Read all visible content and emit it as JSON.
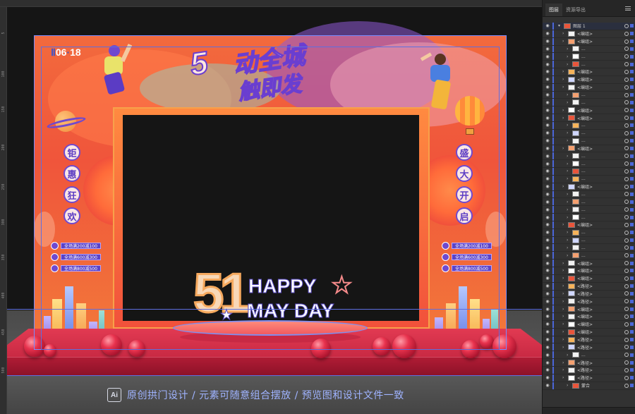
{
  "panel": {
    "tabs": [
      "图层",
      "资源导出"
    ],
    "top_layer": "图层 1",
    "rows": [
      "<编组>",
      "<编组>",
      "...",
      "...",
      "...",
      "<编组>",
      "<编组>",
      "<编组>",
      "...",
      "...",
      "<编组>",
      "<编组>",
      "...",
      "...",
      "...",
      "<编组>",
      "...",
      "...",
      "...",
      "...",
      "<编组>",
      "...",
      "...",
      "...",
      "...",
      "<编组>",
      "...",
      "...",
      "...",
      "...",
      "<编组>",
      "<编组>",
      "<编组>",
      "<路径>",
      "<路径>",
      "<路径>",
      "<编组>",
      "<编组>",
      "<编组>",
      "<编组>",
      "<路径>",
      "<路径>",
      "...",
      "<路径>",
      "<路径>",
      "<路径>",
      "蒙合"
    ]
  },
  "canvas": {
    "ruler_marks": [
      "5",
      "100",
      "150",
      "200",
      "250",
      "300",
      "350",
      "400",
      "450",
      "500"
    ],
    "logo": {
      "prefix": "Ⅱ",
      "date": "06",
      "sep": "·",
      "day": "18"
    },
    "title_numeral": "5",
    "title_line1": "动全城",
    "title_line2": "触即发",
    "left_column": [
      "钜",
      "惠",
      "狂",
      "欢"
    ],
    "right_column": [
      "盛",
      "大",
      "开",
      "启"
    ],
    "coupons_left": [
      "全场满200减100",
      "全场满600减300",
      "全场满800减500"
    ],
    "coupons_right": [
      "全场满200减100",
      "全场满600减300",
      "全场满800减500"
    ],
    "center_numeral": "51",
    "happy": "HAPPY",
    "may_day": "MAY DAY",
    "caption_badge": "Ai",
    "caption": "原创拱门设计 / 元素可随意组合摆放 / 预览图和设计文件一致"
  },
  "colors": {
    "arch_orange": "#f0553b",
    "purple_accent": "#6a3ed0",
    "stage_red": "#d8304a",
    "selection_blue": "#7a8cff"
  }
}
